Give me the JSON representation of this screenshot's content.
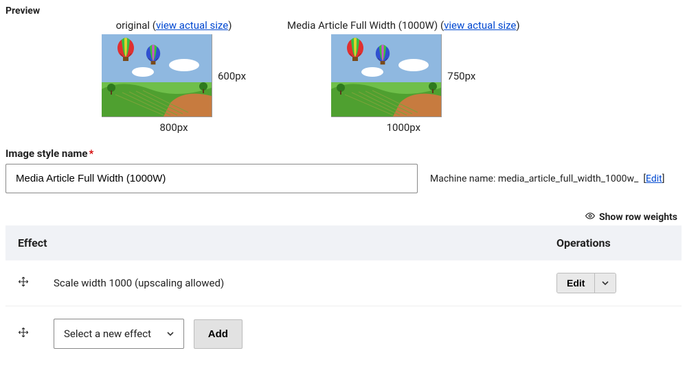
{
  "preview": {
    "section_label": "Preview",
    "original": {
      "caption_prefix": "original (",
      "link_text": "view actual size",
      "caption_suffix": ")",
      "height_label": "600px",
      "width_label": "800px"
    },
    "styled": {
      "caption_prefix": "Media Article Full Width (1000W) (",
      "link_text": "view actual size",
      "caption_suffix": ")",
      "height_label": "750px",
      "width_label": "1000px"
    }
  },
  "form": {
    "name_label": "Image style name",
    "name_value": "Media Article Full Width (1000W)",
    "machine_name_label": "Machine name: ",
    "machine_name_value": "media_article_full_width_1000w_",
    "machine_name_edit": "Edit"
  },
  "table": {
    "show_weights": "Show row weights",
    "col_effect": "Effect",
    "col_operations": "Operations",
    "rows": [
      {
        "label": "Scale width 1000 (upscaling allowed)",
        "edit_label": "Edit"
      }
    ],
    "new_effect_placeholder": "Select a new effect",
    "add_label": "Add"
  }
}
